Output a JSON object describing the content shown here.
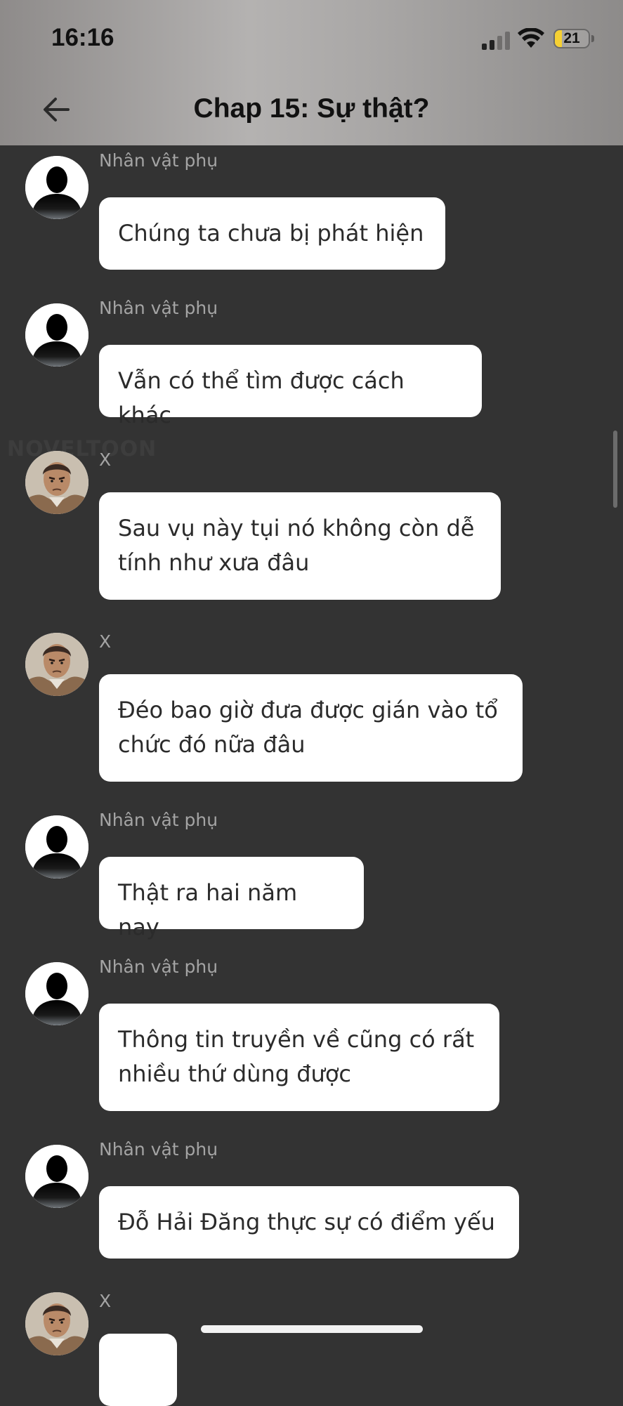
{
  "status_bar": {
    "time": "16:16",
    "battery": "21",
    "battery_level": 0.21
  },
  "header": {
    "title": "Chap 15: Sự thật?",
    "back_icon": "arrow-left-icon"
  },
  "watermark": "NOVELTOON",
  "messages": [
    {
      "sender": "Nhân vật phụ",
      "avatar": "silhouette",
      "text": "Chúng ta chưa bị phát hiện"
    },
    {
      "sender": "Nhân vật phụ",
      "avatar": "silhouette",
      "text": "Vẫn có thể tìm được cách khác"
    },
    {
      "sender": "X",
      "avatar": "portrait",
      "text": "Sau vụ này tụi nó không còn dễ\ntính như xưa đâu"
    },
    {
      "sender": "X",
      "avatar": "portrait",
      "text": "Đéo bao giờ đưa được gián vào tổ\nchức đó nữa đâu"
    },
    {
      "sender": "Nhân vật phụ",
      "avatar": "silhouette",
      "text": "Thật ra hai năm nay"
    },
    {
      "sender": "Nhân vật phụ",
      "avatar": "silhouette",
      "text": "Thông tin truyền về cũng có rất\nnhiều thứ dùng được"
    },
    {
      "sender": "Nhân vật phụ",
      "avatar": "silhouette",
      "text": "Đỗ Hải Đăng thực sự có điểm yếu"
    },
    {
      "sender": "X",
      "avatar": "portrait",
      "text": ""
    }
  ],
  "colors": {
    "background": "#333333",
    "bubble": "#ffffff",
    "name": "#a4a4a4",
    "battery": "#f6d033"
  }
}
